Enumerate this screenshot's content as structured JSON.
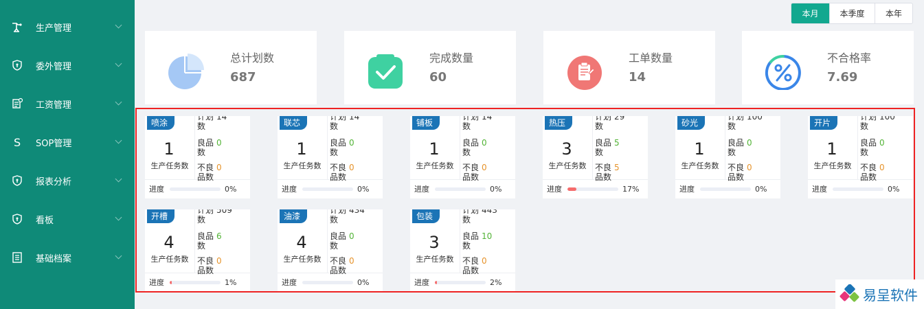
{
  "sidebar": {
    "items": [
      {
        "label": "生产管理",
        "icon": "robot-arm-icon"
      },
      {
        "label": "委外管理",
        "icon": "shield-icon"
      },
      {
        "label": "工资管理",
        "icon": "wage-doc-icon"
      },
      {
        "label": "SOP管理",
        "icon": "letter-s-icon"
      },
      {
        "label": "报表分析",
        "icon": "shield-icon"
      },
      {
        "label": "看板",
        "icon": "shield-icon"
      },
      {
        "label": "基础档案",
        "icon": "document-icon"
      }
    ]
  },
  "period_tabs": {
    "items": [
      {
        "label": "本月"
      },
      {
        "label": "本季度"
      },
      {
        "label": "本年"
      }
    ],
    "active": "本月"
  },
  "stats": [
    {
      "title": "总计划数",
      "value": "687",
      "icon": "pie-chart-icon",
      "color": "#a5c8f5"
    },
    {
      "title": "完成数量",
      "value": "60",
      "icon": "check-box-icon",
      "color": "#3fd1a1"
    },
    {
      "title": "工单数量",
      "value": "14",
      "icon": "clipboard-icon",
      "color": "#f07775"
    },
    {
      "title": "不合格率",
      "value": "7.69",
      "icon": "percent-icon",
      "color": "#3a86e8"
    }
  ],
  "card_labels": {
    "tasks": "生产任务数",
    "plan": "计划数",
    "good": "良品数",
    "bad": "不良品数",
    "progress": "进度"
  },
  "cards": [
    {
      "name": "喷涂",
      "tasks": "1",
      "plan": "14",
      "good": "0",
      "bad": "0",
      "progress": "0%",
      "progress_value": 0
    },
    {
      "name": "联芯",
      "tasks": "1",
      "plan": "14",
      "good": "0",
      "bad": "0",
      "progress": "0%",
      "progress_value": 0
    },
    {
      "name": "铺板",
      "tasks": "1",
      "plan": "14",
      "good": "0",
      "bad": "0",
      "progress": "0%",
      "progress_value": 0
    },
    {
      "name": "热压",
      "tasks": "3",
      "plan": "29",
      "good": "5",
      "bad": "5",
      "progress": "17%",
      "progress_value": 17
    },
    {
      "name": "砂光",
      "tasks": "1",
      "plan": "100",
      "good": "0",
      "bad": "0",
      "progress": "0%",
      "progress_value": 0
    },
    {
      "name": "开片",
      "tasks": "1",
      "plan": "100",
      "good": "0",
      "bad": "0",
      "progress": "0%",
      "progress_value": 0
    },
    {
      "name": "开槽",
      "tasks": "4",
      "plan": "509",
      "good": "6",
      "bad": "0",
      "progress": "1%",
      "progress_value": 1
    },
    {
      "name": "油漆",
      "tasks": "4",
      "plan": "434",
      "good": "0",
      "bad": "0",
      "progress": "0%",
      "progress_value": 0
    },
    {
      "name": "包装",
      "tasks": "3",
      "plan": "443",
      "good": "10",
      "bad": "0",
      "progress": "2%",
      "progress_value": 2
    }
  ],
  "logo": {
    "text": "易呈软件",
    "icon": "yicheng-logo-icon"
  }
}
